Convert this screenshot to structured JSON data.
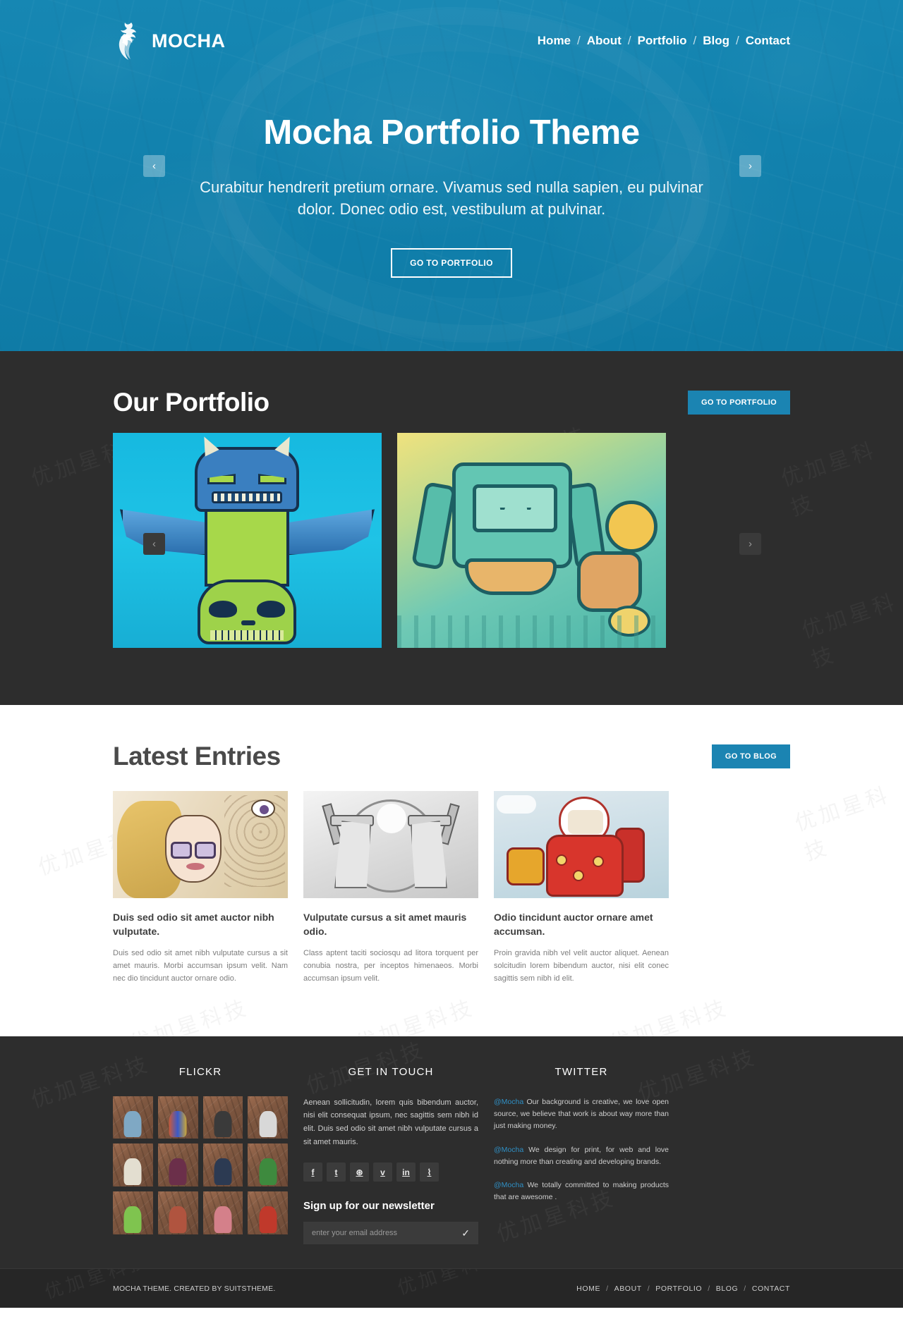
{
  "brand": {
    "name": "MOCHA",
    "logo_icon": "rooster-logo-icon"
  },
  "nav": {
    "items": [
      "Home",
      "About",
      "Portfolio",
      "Blog",
      "Contact"
    ],
    "separator": "/"
  },
  "hero": {
    "title": "Mocha Portfolio Theme",
    "subtitle": "Curabitur hendrerit pretium ornare. Vivamus sed nulla sapien, eu pulvinar dolor. Donec odio est, vestibulum at pulvinar.",
    "cta": "GO TO PORTFOLIO",
    "prev_icon": "chevron-left-icon",
    "next_icon": "chevron-right-icon",
    "bg_color": "#1384b0"
  },
  "portfolio": {
    "title": "Our Portfolio",
    "cta": "GO TO PORTFOLIO",
    "prev_icon": "chevron-left-icon",
    "next_icon": "chevron-right-icon",
    "bg_color": "#2d2d2d",
    "items": [
      {
        "alt": "blue and green winged totem monster illustration"
      },
      {
        "alt": "teal and yellow graffiti robot character illustration"
      }
    ]
  },
  "blog": {
    "title": "Latest Entries",
    "cta": "GO TO BLOG",
    "posts": [
      {
        "title": "Duis sed odio sit amet auctor nibh vulputate.",
        "excerpt": "Duis sed odio sit amet nibh vulputate cursus a sit amet mauris. Morbi accumsan ipsum velit. Nam nec dio tincidunt auctor ornare odio.",
        "alt": "illustrated portrait of a woman with glasses and ornate hair"
      },
      {
        "title": "Vulputate cursus a sit amet mauris odio.",
        "excerpt": "Class aptent taciti sociosqu ad litora torquent per conubia nostra, per inceptos himenaeos. Morbi accumsan ipsum velit.",
        "alt": "greyscale illustration of two figures duelling with pistols"
      },
      {
        "title": "Odio tincidunt auctor ornare amet accumsan.",
        "excerpt": "Proin gravida nibh vel velit auctor aliquet. Aenean solcitudin lorem bibendum auctor, nisi elit conec sagittis sem nibh id elit.",
        "alt": "red cartoon astronaut robot illustration"
      }
    ]
  },
  "footer": {
    "flickr": {
      "heading": "FLICKR",
      "thumb_count": 12,
      "thumb_alt": "flickr photo thumbnail"
    },
    "contact": {
      "heading": "GET IN TOUCH",
      "text": "Aenean sollicitudin, lorem quis bibendum auctor, nisi elit consequat ipsum, nec sagittis sem nibh id elit. Duis sed odio sit amet nibh vulputate cursus a sit amet mauris.",
      "social": [
        {
          "icon": "facebook-icon",
          "glyph": "f"
        },
        {
          "icon": "tumblr-icon",
          "glyph": "t"
        },
        {
          "icon": "dribbble-icon",
          "glyph": "⊛"
        },
        {
          "icon": "vimeo-icon",
          "glyph": "v"
        },
        {
          "icon": "linkedin-icon",
          "glyph": "in"
        },
        {
          "icon": "rss-icon",
          "glyph": "⌇"
        }
      ],
      "newsletter_heading": "Sign up for our newsletter",
      "newsletter_placeholder": "enter your email address",
      "newsletter_value": "",
      "newsletter_submit_icon": "check-icon",
      "newsletter_submit_glyph": "✓"
    },
    "twitter": {
      "heading": "TWITTER",
      "handle": "@Mocha",
      "handle_color": "#2f8fc4",
      "tweets": [
        "Our background is creative, we love open source, we believe that work is about way more than just making money.",
        "We design for print, for web and love nothing more than creating and developing brands.",
        "We totally committed to making products that are awesome ."
      ]
    }
  },
  "copyright": {
    "text": "MOCHA THEME. CREATED BY SUITSTHEME.",
    "nav": [
      "HOME",
      "ABOUT",
      "PORTFOLIO",
      "BLOG",
      "CONTACT"
    ],
    "separator": "/"
  },
  "watermark": {
    "text": "优加星科技"
  }
}
